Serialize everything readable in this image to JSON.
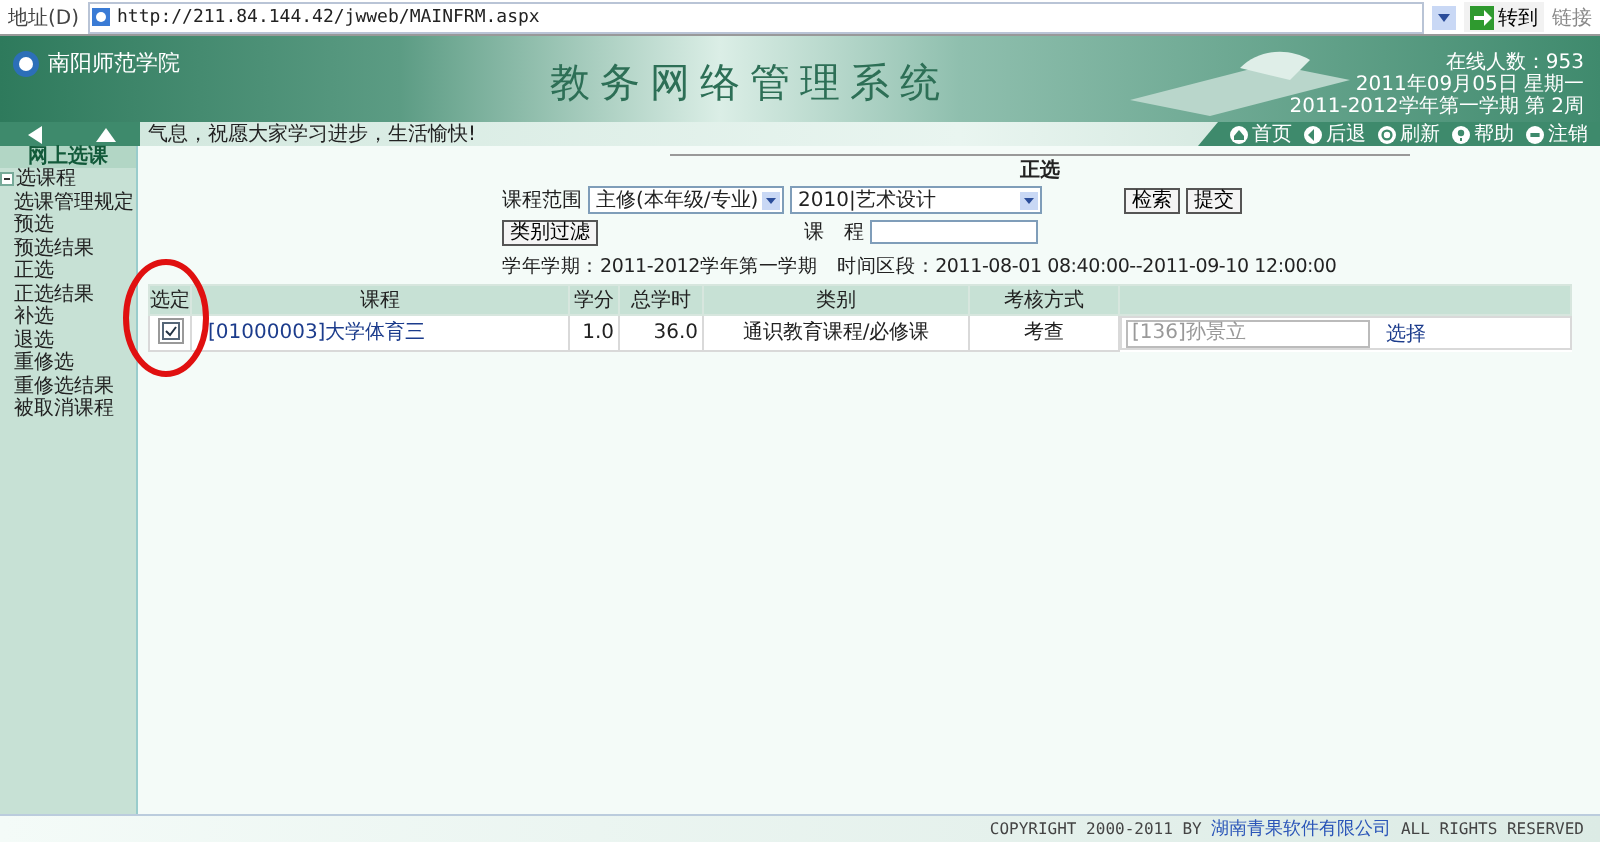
{
  "browser": {
    "address_label": "地址(D)",
    "url": "http://211.84.144.42/jwweb/MAINFRM.aspx",
    "go": "转到",
    "links": "链接"
  },
  "header": {
    "logo": "南阳师范学院",
    "title": "教务网络管理系统",
    "online": "在线人数：953",
    "date": "2011年09月05日 星期一",
    "term": "2011-2012学年第一学期 第 2周"
  },
  "notice": "气息，祝愿大家学习进步，生活愉快!",
  "nav": [
    {
      "label": "首页",
      "kind": "home"
    },
    {
      "label": "后退",
      "kind": "back"
    },
    {
      "label": "刷新",
      "kind": "refresh"
    },
    {
      "label": "帮助",
      "kind": "help"
    },
    {
      "label": "注销",
      "kind": "logout"
    }
  ],
  "sidebar": {
    "title": "网上选课",
    "items": [
      {
        "label": "选课程",
        "expanded": true,
        "children": [
          {
            "label": "选课管理规定"
          },
          {
            "label": "预选"
          },
          {
            "label": "预选结果"
          },
          {
            "label": "正选"
          },
          {
            "label": "正选结果"
          },
          {
            "label": "补选"
          },
          {
            "label": "退选"
          },
          {
            "label": "重修选"
          },
          {
            "label": "重修选结果"
          },
          {
            "label": "被取消课程"
          }
        ]
      }
    ]
  },
  "form": {
    "title": "正选",
    "range_label": "课程范围",
    "range_select": "主修(本年级/专业)",
    "major_select": "2010|艺术设计",
    "search_button": "检索",
    "submit_button": "提交",
    "filter_button": "类别过滤",
    "course_label": "课　程",
    "term_info": "学年学期：2011-2012学年第一学期　时间区段：2011-08-01 08:40:00--2011-09-10 12:00:00"
  },
  "table": {
    "columns": [
      "选定",
      "课程",
      "学分",
      "总学时",
      "类别",
      "考核方式"
    ],
    "rows": [
      {
        "checked": true,
        "course": "[01000003]大学体育三",
        "credit": "1.0",
        "hours": "36.0",
        "category": "通识教育课程/必修课",
        "exam": "考查",
        "teacher": "[136]孙景立",
        "action": "选择"
      }
    ]
  },
  "annotation": {
    "kind": "circle",
    "color": "#e01010"
  },
  "footer": {
    "prefix": "COPYRIGHT 2000-2011 BY",
    "company": "湖南青果软件有限公司",
    "suffix": "ALL RIGHTS RESERVED"
  }
}
